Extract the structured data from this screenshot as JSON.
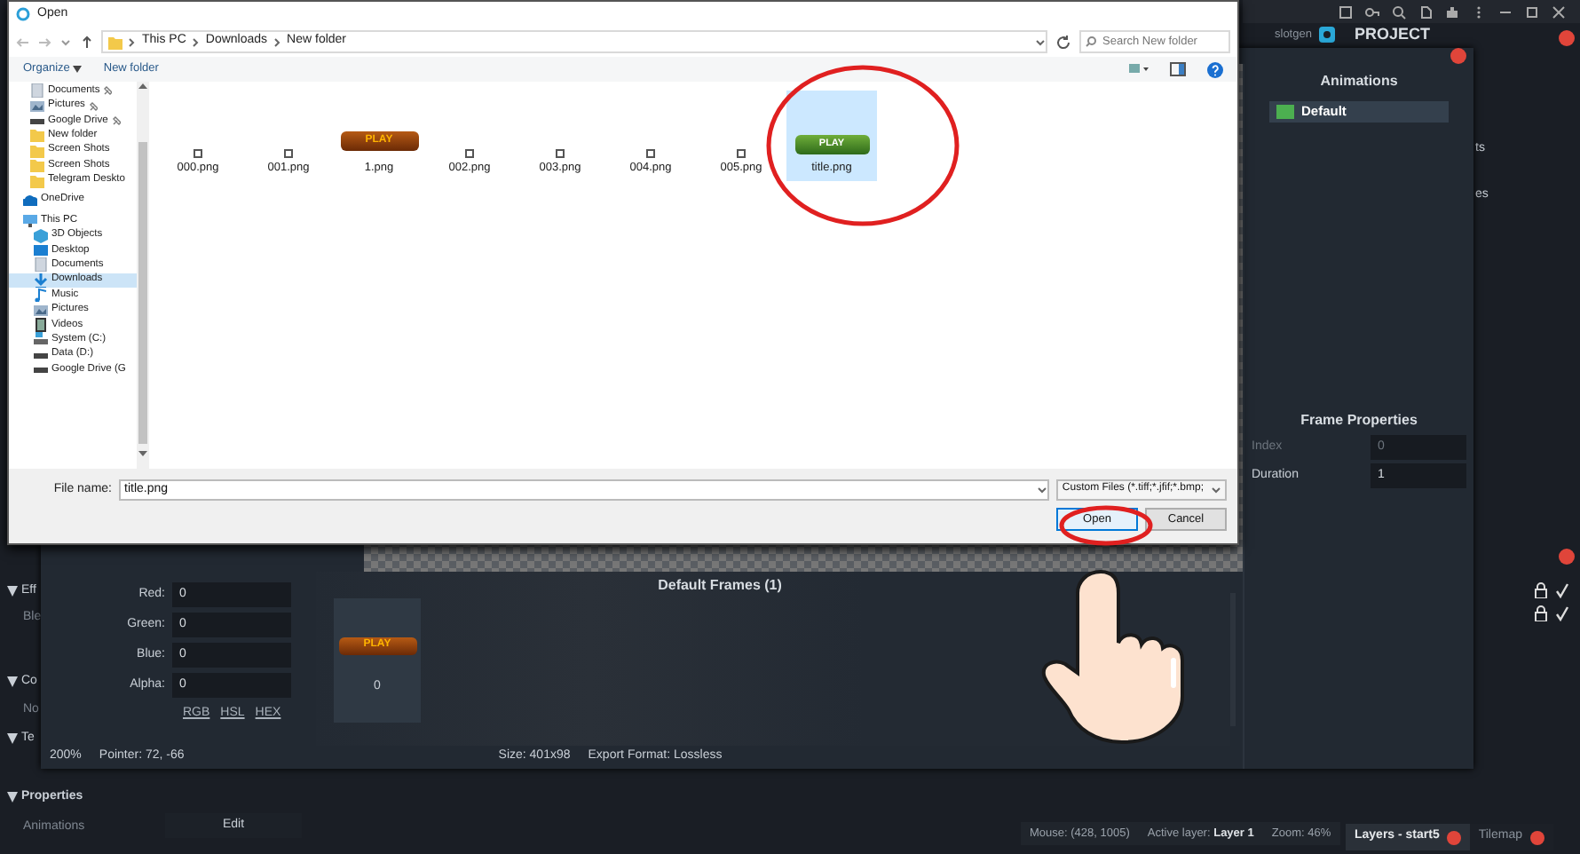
{
  "app": {
    "brand": "slotgen",
    "panel_title": "PROJECT",
    "side_fragments": [
      "ts",
      "es"
    ],
    "layer_rows": [
      {
        "locked": true,
        "visible": true
      },
      {
        "locked": true,
        "visible": true
      }
    ],
    "left_sections": [
      {
        "label": "Eff",
        "expanded": true,
        "rows": [
          "Ble"
        ]
      },
      {
        "label": "Co",
        "expanded": true,
        "rows": [
          "No"
        ]
      },
      {
        "label": "Te",
        "expanded": true
      }
    ],
    "properties": {
      "label": "Properties",
      "expanded": true,
      "rows": [
        {
          "label": "Animations",
          "button": "Edit"
        }
      ]
    },
    "status_bar": {
      "mouse": "Mouse: (428, 1005)",
      "active_layer_label": "Active layer:",
      "active_layer": "Layer 1",
      "zoom": "Zoom: 46%"
    },
    "bottom_tabs": [
      {
        "label": "Layers - start5",
        "selected": true
      },
      {
        "label": "Tilemap",
        "selected": false
      }
    ]
  },
  "animation_editor": {
    "animations_title": "Animations",
    "animations": [
      {
        "name": "Default",
        "selected": true
      }
    ],
    "frame_properties": {
      "title": "Frame Properties",
      "fields": [
        {
          "label": "Index",
          "value": "0",
          "disabled": true
        },
        {
          "label": "Duration",
          "value": "1",
          "disabled": false
        }
      ]
    },
    "color_fields": [
      {
        "label": "Red:",
        "value": "0"
      },
      {
        "label": "Green:",
        "value": "0"
      },
      {
        "label": "Blue:",
        "value": "0"
      },
      {
        "label": "Alpha:",
        "value": "0"
      }
    ],
    "color_modes": [
      "RGB",
      "HSL",
      "HEX"
    ],
    "frames_title": "Default Frames (1)",
    "frames": [
      {
        "image_label": "PLAY",
        "index": "0"
      }
    ],
    "zoom": "200%",
    "pointer": "Pointer: 72, -66",
    "size": "Size: 401x98",
    "export_format": "Export Format: Lossless"
  },
  "file_dialog": {
    "title": "Open",
    "breadcrumb": [
      "This PC",
      "Downloads",
      "New folder"
    ],
    "search_placeholder": "Search New folder",
    "toolbar": [
      "Organize",
      "New folder"
    ],
    "quick_access": [
      {
        "label": "Documents",
        "kind": "doc",
        "pinned": true,
        "selected": false
      },
      {
        "label": "Pictures",
        "kind": "pictures",
        "pinned": true,
        "selected": false
      },
      {
        "label": "Google Drive",
        "kind": "drive",
        "pinned": true,
        "selected": false
      },
      {
        "label": "New folder",
        "kind": "folder",
        "pinned": false,
        "selected": false
      },
      {
        "label": "Screen Shots",
        "kind": "folder",
        "pinned": false,
        "selected": false
      },
      {
        "label": "Screen Shots",
        "kind": "folder",
        "pinned": false,
        "selected": false
      },
      {
        "label": "Telegram Deskto",
        "kind": "folder",
        "pinned": false,
        "selected": false
      }
    ],
    "nav": [
      {
        "label": "OneDrive",
        "kind": "cloud",
        "selected": false
      },
      {
        "label": "This PC",
        "kind": "pc",
        "selected": false,
        "children": [
          {
            "label": "3D Objects",
            "kind": "cube",
            "selected": false
          },
          {
            "label": "Desktop",
            "kind": "desktop",
            "selected": false
          },
          {
            "label": "Documents",
            "kind": "doc",
            "selected": false
          },
          {
            "label": "Downloads",
            "kind": "download",
            "selected": true
          },
          {
            "label": "Music",
            "kind": "music",
            "selected": false
          },
          {
            "label": "Pictures",
            "kind": "pictures",
            "selected": false
          },
          {
            "label": "Videos",
            "kind": "video",
            "selected": false
          },
          {
            "label": "System (C:)",
            "kind": "system",
            "selected": false
          },
          {
            "label": "Data (D:)",
            "kind": "drive",
            "selected": false
          },
          {
            "label": "Google Drive (G",
            "kind": "drive",
            "selected": false
          }
        ]
      }
    ],
    "files": [
      {
        "name": "000.png",
        "kind": "tiny",
        "selected": false
      },
      {
        "name": "001.png",
        "kind": "tiny",
        "selected": false
      },
      {
        "name": "1.png",
        "kind": "button",
        "image_label": "PLAY",
        "selected": false
      },
      {
        "name": "002.png",
        "kind": "tiny",
        "selected": false
      },
      {
        "name": "003.png",
        "kind": "tiny",
        "selected": false
      },
      {
        "name": "004.png",
        "kind": "tiny",
        "selected": false
      },
      {
        "name": "005.png",
        "kind": "tiny",
        "selected": false
      },
      {
        "name": "title.png",
        "kind": "banner",
        "image_label": "PLAY",
        "selected": true
      }
    ],
    "file_name_label": "File name:",
    "file_name": "title.png",
    "file_type": "Custom Files (*.tiff;*.jfif;*.bmp;",
    "buttons": [
      {
        "label": "Open",
        "kind": "primary"
      },
      {
        "label": "Cancel",
        "kind": "secondary"
      }
    ]
  }
}
